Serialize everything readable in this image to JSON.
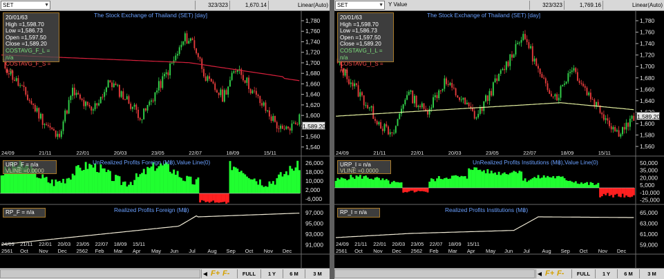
{
  "panels": [
    {
      "side": "left",
      "header": {
        "symbol": "SET",
        "y_value": "",
        "counter": "323/323",
        "value": "1,670.14",
        "scale": "Linear(Auto)"
      },
      "chart_title": "The Stock Exchange of Thailand (SET) [day]",
      "ohlc": {
        "date": "20/01/63",
        "high": "High  =1,598.70",
        "low": "Low  =1,586.73",
        "open": "Open  =1,597.50",
        "close": "Close  =1,589.20",
        "ind1": "COSTAVG_F_L   = n/a",
        "ind2": "COSTAVG_F_S   = n/a"
      },
      "ind2_color": "#ff3d3d",
      "last_price": "1,589.20",
      "price_ticks": [
        "1,780",
        "1,760",
        "1,740",
        "1,720",
        "1,700",
        "1,680",
        "1,660",
        "1,640",
        "1,620",
        "1,600",
        "1,580",
        "1,560",
        "1,540"
      ],
      "sub1": {
        "title": "UnRealized Profits Foreign (M฿),Value Line(0)",
        "line1": "URP_F   = n/a",
        "line2": "VLINE   =0.0000",
        "ticks": [
          "26,000",
          "18,000",
          "10,000",
          "2,000",
          "-6,000"
        ]
      },
      "sub2": {
        "title": "Realized Profits Foreign (M฿)",
        "line1": "RP_F    = n/a",
        "ticks": [
          "97,000",
          "95,000",
          "93,000",
          "91,000"
        ]
      },
      "x_dates": [
        "24/09",
        "21/11",
        "22/01",
        "20/03",
        "23/05",
        "22/07",
        "18/09",
        "15/11"
      ],
      "x_months": [
        "2561",
        "Oct",
        "Nov",
        "Dec",
        "2562",
        "Feb",
        "Mar",
        "Apr",
        "May",
        "Jun",
        "Jul",
        "Aug",
        "Sep",
        "Oct",
        "Nov",
        "Dec"
      ],
      "toolbar": {
        "full": "FULL",
        "y1": "1 Y",
        "m6": "6 M",
        "m3": "3 M"
      }
    },
    {
      "side": "right",
      "header": {
        "symbol": "SET",
        "y_value": "Y Value",
        "counter": "323/323",
        "value": "1,769.16",
        "scale": "Linear(Auto)"
      },
      "chart_title": "The Stock Exchange of Thailand (SET) [day]",
      "ohlc": {
        "date": "20/01/63",
        "high": "High  =1,598.70",
        "low": "Low  =1,586.73",
        "open": "Open  =1,597.50",
        "close": "Close  =1,589.20",
        "ind1": "COSTAVG_I_L   = n/a",
        "ind2": "COSTAVG_I_S   = n/a"
      },
      "ind2_color": "#ff3d3d",
      "last_price": "1,589.20",
      "price_ticks": [
        "1,780",
        "1,760",
        "1,740",
        "1,720",
        "1,700",
        "1,680",
        "1,660",
        "1,640",
        "1,620",
        "1,600",
        "1,580",
        "1,560"
      ],
      "sub1": {
        "title": "UnRealized Profits Institutions (M฿),Value Line(0)",
        "line1": "URP_I   = n/a",
        "line2": "VLINE   =0.0000",
        "ticks": [
          "50,000",
          "35,000",
          "20,000",
          "5,000",
          "-10,000",
          "-25,000"
        ]
      },
      "sub2": {
        "title": "Realized Profits Institutions (M฿)",
        "line1": "RP_I    = n/a",
        "ticks": [
          "65,000",
          "63,000",
          "61,000",
          "59,000"
        ]
      },
      "x_dates": [
        "24/09",
        "21/11",
        "22/01",
        "20/03",
        "23/05",
        "22/07",
        "18/09",
        "15/11"
      ],
      "x_months": [
        "2561",
        "Oct",
        "Nov",
        "Dec",
        "2562",
        "Feb",
        "Mar",
        "Apr",
        "May",
        "Jun",
        "Jul",
        "Aug",
        "Sep",
        "Oct",
        "Nov",
        "Dec"
      ],
      "toolbar": {
        "full": "FULL",
        "y1": "1 Y",
        "m6": "6 M",
        "m3": "3 M"
      }
    }
  ],
  "colors": {
    "bull": "#33d24a",
    "bear": "#e33b3b",
    "left_ma": "#d8203c",
    "right_ma": "#e4f0a0",
    "area_pos": "#20ff30",
    "area_neg": "#ff2020",
    "realized": "#f0ead6",
    "title": "#6aa0ff"
  }
}
